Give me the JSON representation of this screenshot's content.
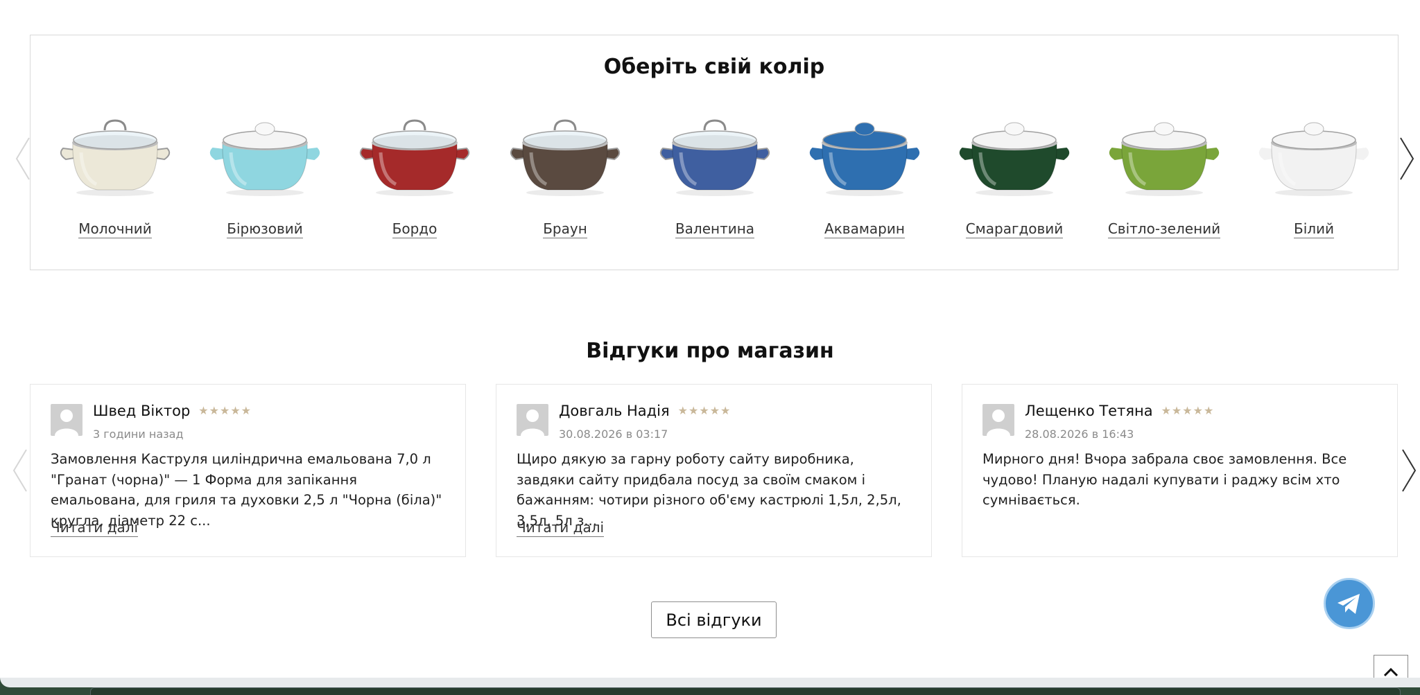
{
  "colors_section": {
    "title": "Оберіть свій колір",
    "swatches": [
      {
        "label": "Молочний",
        "color": "#ece8d8",
        "lid": "glass"
      },
      {
        "label": "Бірюзовий",
        "color": "#8fd6e0",
        "lid": "white"
      },
      {
        "label": "Бордо",
        "color": "#a52a2a",
        "lid": "glass"
      },
      {
        "label": "Браун",
        "color": "#5a4a40",
        "lid": "glass"
      },
      {
        "label": "Валентина",
        "color": "#3f5fa0",
        "lid": "glass"
      },
      {
        "label": "Аквамарин",
        "color": "#2e6fb0",
        "lid": "same"
      },
      {
        "label": "Смарагдовий",
        "color": "#1f4a2c",
        "lid": "white"
      },
      {
        "label": "Світло-зелений",
        "color": "#7aa53a",
        "lid": "white"
      },
      {
        "label": "Білий",
        "color": "#f2f2f2",
        "lid": "white"
      }
    ]
  },
  "reviews_section": {
    "title": "Відгуки про магазин",
    "stars": "★★★★★",
    "star_color": "#c9b89a",
    "reviews": [
      {
        "name": "Швед Віктор",
        "date": "3 години назад",
        "text": "Замовлення Каструля циліндрична емальована 7,0 л \"Гранат (чорна)\" — 1 Форма для запікання емальована, для гриля та духовки 2,5 л \"Чорна (біла)\" кругла, діаметр 22 с...",
        "read_more": "Читати далі"
      },
      {
        "name": "Довгаль Надія",
        "date": "30.08.2026 в 03:17",
        "text": "Щиро дякую за гарну роботу сайту виробника, завдяки сайту придбала посуд за своїм смаком і бажанням: чотири різного об'єму кастрюлі 1,5л, 2,5л, 3,5л, 5л з...",
        "read_more": "Читати далі"
      },
      {
        "name": "Лещенко Тетяна",
        "date": "28.08.2026 в 16:43",
        "text": "Мирного дня! Вчора забрала своє замовлення. Все чудово! Планую надалі купувати і раджу всім хто сумнівається.",
        "read_more": ""
      }
    ],
    "all_reviews_button": "Всі відгуки"
  },
  "icons": {
    "prev": "chevron-left-icon",
    "next": "chevron-right-icon",
    "telegram": "telegram-icon",
    "to_top": "chevron-up-icon",
    "avatar": "user-placeholder-icon"
  },
  "accent_colors": {
    "telegram": "#4a96d6",
    "footer": "#2f4a38"
  }
}
